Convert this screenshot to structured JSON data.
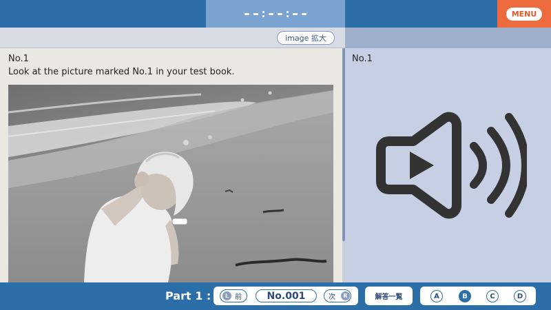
{
  "header": {
    "menu_label": "MENU"
  },
  "toolbar": {
    "zoom_label": "image 拡大"
  },
  "question": {
    "number": "No.1",
    "instruction": "Look at the picture marked No.1 in your test book."
  },
  "audio_panel": {
    "number": "No.1",
    "icon": "speaker-icon"
  },
  "footer": {
    "part_label": "Part 1 :",
    "prev_badge": "L",
    "prev_label": "前",
    "current_number": "No.001",
    "next_label": "次",
    "next_badge": "R",
    "answers_label": "解答一覧",
    "choices": [
      "A",
      "B",
      "C",
      "D"
    ],
    "selected_choice": "B"
  },
  "colors": {
    "header_blue": "#2c6ea8",
    "timer_blue": "#7ba3cf",
    "menu_orange": "#ec6a3c",
    "audio_panel_bg": "#c6cfe3",
    "question_panel_bg": "#ebe8e3"
  }
}
